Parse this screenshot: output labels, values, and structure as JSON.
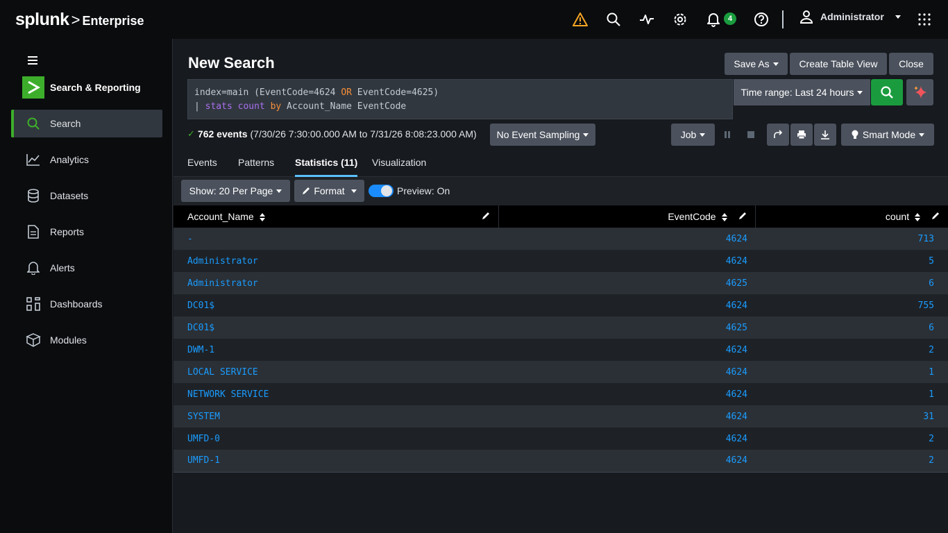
{
  "brand": {
    "logo_main": "splunk",
    "logo_sep": ">",
    "logo_product": "Enterprise"
  },
  "topbar": {
    "notifications_count": "4",
    "user_name": "Administrator"
  },
  "app": {
    "name": "Search & Reporting"
  },
  "nav": [
    {
      "label": "Search",
      "icon": "search-icon"
    },
    {
      "label": "Analytics",
      "icon": "analytics-icon"
    },
    {
      "label": "Datasets",
      "icon": "database-icon"
    },
    {
      "label": "Reports",
      "icon": "report-icon"
    },
    {
      "label": "Alerts",
      "icon": "bell-icon"
    },
    {
      "label": "Dashboards",
      "icon": "dashboard-icon"
    },
    {
      "label": "Modules",
      "icon": "modules-icon"
    }
  ],
  "page": {
    "title": "New Search",
    "save_as": "Save As",
    "create_table_view": "Create Table View",
    "close": "Close"
  },
  "search": {
    "line1_a": "index=main (EventCode=4624 ",
    "line1_or": "OR",
    "line1_b": " EventCode=4625)",
    "line2_pipe": "| ",
    "line2_cmd": "stats count",
    "line2_c": " ",
    "line2_by": "by",
    "line2_d": " Account_Name EventCode",
    "time_range": "Time range: Last 24 hours"
  },
  "status": {
    "count": "762 events",
    "range": "(7/30/26 7:30:00.000 AM to 7/31/26 8:08:23.000 AM)",
    "sampling": "No Event Sampling",
    "job": "Job",
    "mode": "Smart Mode"
  },
  "tabs": [
    "Events",
    "Patterns",
    "Statistics (11)",
    "Visualization"
  ],
  "toolbar": {
    "show": "Show: 20 Per Page",
    "format": "Format",
    "preview": "Preview: On"
  },
  "table": {
    "columns": [
      "Account_Name",
      "EventCode",
      "count"
    ],
    "rows": [
      [
        "-",
        "4624",
        "713"
      ],
      [
        "Administrator",
        "4624",
        "5"
      ],
      [
        "Administrator",
        "4625",
        "6"
      ],
      [
        "DC01$",
        "4624",
        "755"
      ],
      [
        "DC01$",
        "4625",
        "6"
      ],
      [
        "DWM-1",
        "4624",
        "2"
      ],
      [
        "LOCAL SERVICE",
        "4624",
        "1"
      ],
      [
        "NETWORK SERVICE",
        "4624",
        "1"
      ],
      [
        "SYSTEM",
        "4624",
        "31"
      ],
      [
        "UMFD-0",
        "4624",
        "2"
      ],
      [
        "UMFD-1",
        "4624",
        "2"
      ]
    ]
  },
  "colors": {
    "accent_green": "#3dae2b",
    "link_blue": "#1a9cff",
    "warning": "#f5a623",
    "tab_underline": "#5cc0ff"
  }
}
